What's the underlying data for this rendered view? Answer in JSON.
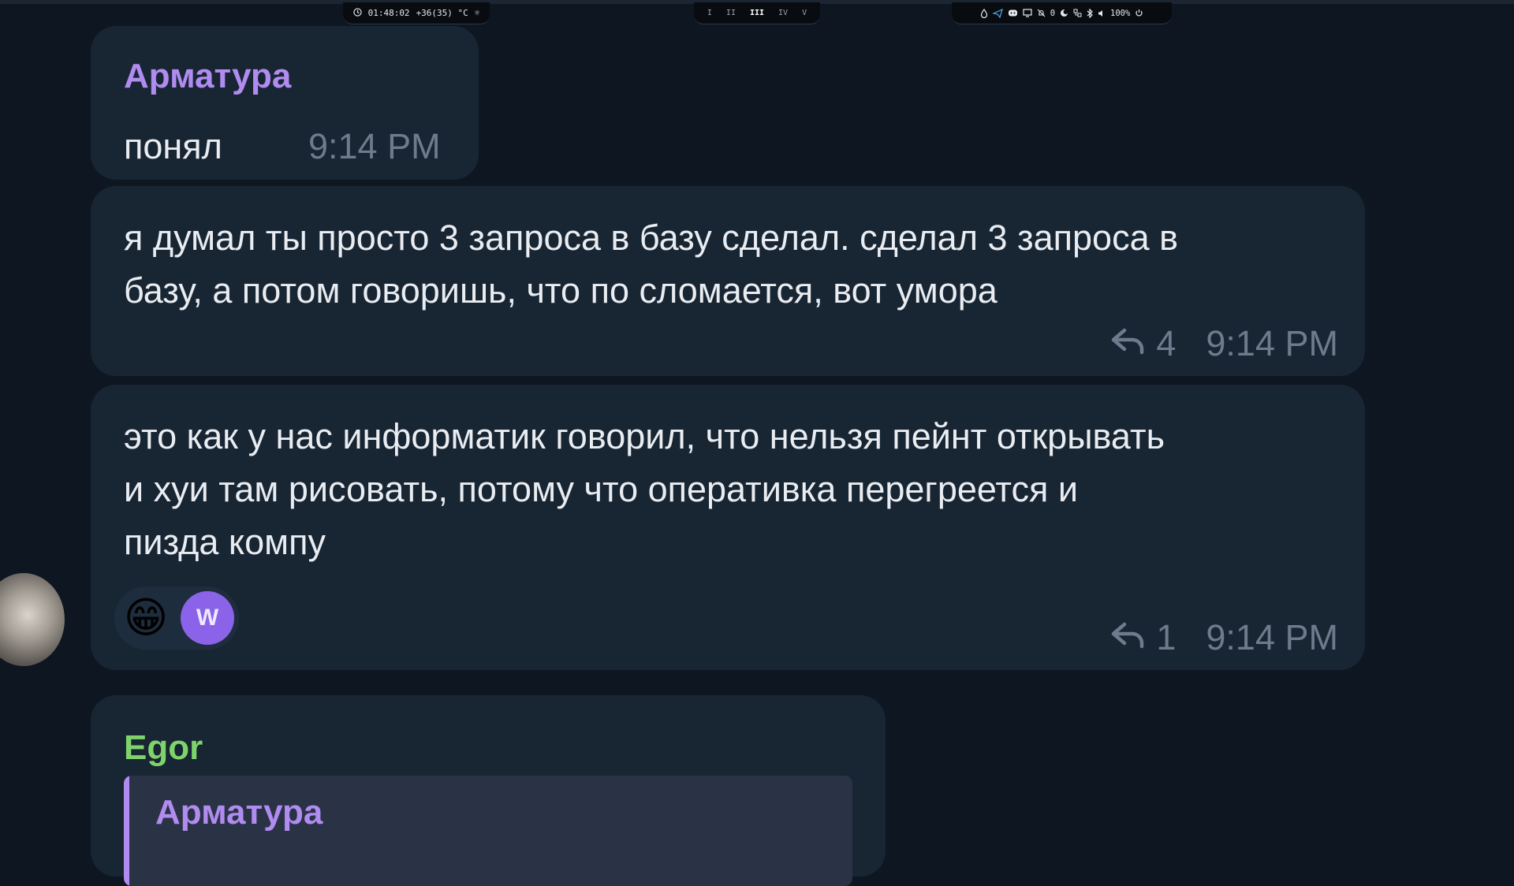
{
  "statusbar": {
    "clock": "01:48:02",
    "temp": "+36(35) °C",
    "workspaces": [
      "I",
      "II",
      "III",
      "IV",
      "V"
    ],
    "active_workspace": "III",
    "notifications": "0",
    "volume": "100%"
  },
  "messages": [
    {
      "sender": "Арматура",
      "text": "понял",
      "time": "9:14 PM"
    },
    {
      "text": "я думал ты просто 3 запроса в базу сделал. сделал 3 запроса в\nбазу, а потом говоришь, что по сломается, вот умора",
      "replies": "4",
      "time": "9:14 PM"
    },
    {
      "text": "это как у нас информатик говорил, что нельзя пейнт открывать\nи хуи там рисовать, потому что оперативка перегреется и\nпизда компу",
      "reactions": [
        {
          "type": "emoji",
          "value": "😁"
        },
        {
          "type": "avatar",
          "value": "W"
        }
      ],
      "replies": "1",
      "time": "9:14 PM"
    },
    {
      "sender": "Egor",
      "quote_sender": "Арматура"
    }
  ],
  "colors": {
    "background": "#0e1621",
    "bubble": "#182533",
    "purple_name": "#b18cf0",
    "green_name": "#7ed36b",
    "meta": "#6d7b8c"
  }
}
